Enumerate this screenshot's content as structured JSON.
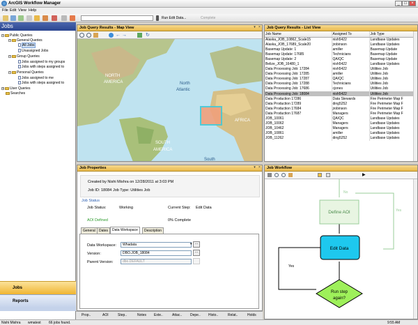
{
  "app": {
    "title": "ArcGIS Workflow Manager"
  },
  "menu": [
    "File",
    "Edit",
    "View",
    "Help"
  ],
  "toolbar": {
    "run_edit": "Run Edit Data...",
    "complete": "Complete"
  },
  "tree": {
    "public": "Public Queries",
    "general": "General Queries",
    "all_jobs": "All Jobs",
    "unassigned": "Unassigned Jobs",
    "group": "Group Queries",
    "assigned_groups": "Jobs assigned to my groups",
    "steps_groups": "Jobs with steps assigned to",
    "personal": "Personal Queries",
    "assigned_me": "Jobs assigned to me",
    "steps_me": "Jobs with steps assigned to",
    "user": "User Queries",
    "searches": "Searches"
  },
  "left": {
    "jobs_header": "Jobs",
    "jobs_btn": "Jobs",
    "reports_btn": "Reports"
  },
  "map": {
    "title": "Job Query Results - Map View",
    "labels": {
      "north": "NORTH",
      "america": "AMERICA",
      "north_atl": "North",
      "atlantic": "Atlantic",
      "africa": "AFRICA",
      "south": "SOUTH",
      "samerica": "AMERICA",
      "south2": "South"
    }
  },
  "list": {
    "title": "Job Query Results - List View",
    "headers": [
      "Job Name",
      "Assigned To",
      "Job Type"
    ],
    "rows": [
      [
        "Alaska_JOB_10862_Scale15",
        "nish5422",
        "Landbase Updates"
      ],
      [
        "Alaska_JOB_17689_Scale20",
        "jrobinson",
        "Landbase Updates"
      ],
      [
        "Basemap Update: 1",
        "amiller",
        "Basemap Update"
      ],
      [
        "Basemap Update: 17685",
        "Technicians",
        "Basemap Update"
      ],
      [
        "Basemap Update: 2",
        "QA/QC",
        "Basemap Update"
      ],
      [
        "Belize_JOB_16480_1",
        "nish5422",
        "Landbase Updates"
      ],
      [
        "Data Processing Job: 17284",
        "nish5422",
        "Utilities Job"
      ],
      [
        "Data Processing Job: 17285",
        "amiller",
        "Utilities Job"
      ],
      [
        "Data Processing Job: 17287",
        "QA/QC",
        "Utilities Job"
      ],
      [
        "Data Processing Job: 17288",
        "Technicians",
        "Utilities Job"
      ],
      [
        "Data Processing Job: 17686",
        "cjones",
        "Utilities Job"
      ],
      [
        "Data Processing Job: 18084",
        "nish5422",
        "Utilities Job"
      ],
      [
        "Data Production 17286",
        "Data Stewards",
        "Fire Perimeter Map F"
      ],
      [
        "Data Production 17289",
        "ding5252",
        "Fire Perimeter Map F"
      ],
      [
        "Data Production 17684",
        "jrobinson",
        "Fire Perimeter Map F"
      ],
      [
        "Data Production 17687",
        "Managers",
        "Fire Perimeter Map F"
      ],
      [
        "JOB_10061",
        "QA/QC",
        "Landbase Updates"
      ],
      [
        "JOB_10062",
        "Managers",
        "Landbase Updates"
      ],
      [
        "JOB_10462",
        "Managers",
        "Landbase Updates"
      ],
      [
        "JOB_10861",
        "amiller",
        "Landbase Updates"
      ],
      [
        "JOB_11262",
        "ding5252",
        "Landbase Updates"
      ]
    ],
    "selected": 11
  },
  "props": {
    "title": "Job Properties",
    "created": "Created by Nishi Mishra on 12/28/2011 at 3:03 PM",
    "jobid": "Job ID: 18084",
    "jobtype": "Job Type: Utilities Job",
    "status_group": "Job Status",
    "status_label": "Job Status:",
    "status_val": "Working",
    "step_label": "Current Step:",
    "step_val": "Edit Data",
    "aoi": "AOI Defined",
    "complete": "0% Complete",
    "tabs": [
      "General",
      "Dates",
      "Data Workspace",
      "Description"
    ],
    "dw_label": "Data Workspace:",
    "dw_val": "Whadata",
    "ver_label": "Version:",
    "ver_val": "DBO.JOB_18084",
    "parent_label": "Parent Version:",
    "parent_val": "dbo.DEFAULT"
  },
  "workflow": {
    "title": "Job Workflow",
    "no": "No",
    "yes": "Yes",
    "define": "Define AOI",
    "edit": "Edit Data",
    "run": "Run step again?",
    "yes2": "Yes"
  },
  "bottom_tabs": [
    "Prop..",
    "AOI",
    "Step..",
    "Notes",
    "Exte..",
    "Attac..",
    "Depe..",
    "Histo..",
    "Relat..",
    "Holds"
  ],
  "status": {
    "user": "Nishi Mishra",
    "db": "wmatest",
    "found": "66 jobs found.",
    "time": "9:55 AM"
  }
}
